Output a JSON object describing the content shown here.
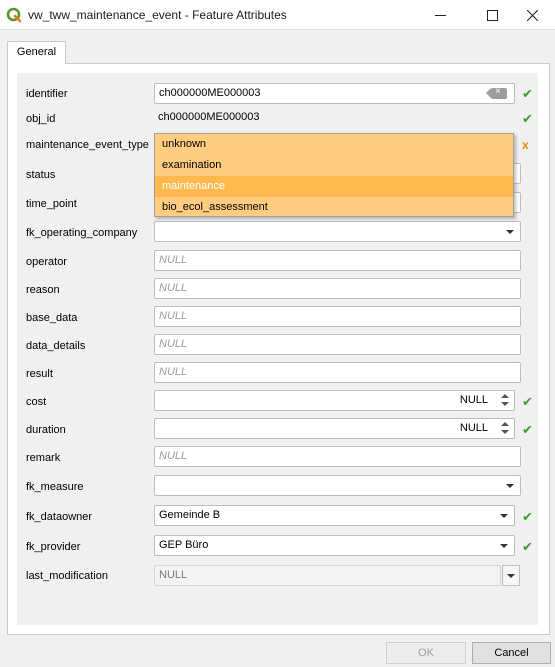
{
  "window": {
    "title": "vw_tww_maintenance_event - Feature Attributes",
    "icon": "qgis-icon",
    "controls": [
      "minimize-icon",
      "maximize-icon",
      "close-icon"
    ]
  },
  "tabs": [
    {
      "label": "General"
    }
  ],
  "fields": {
    "identifier": {
      "label": "identifier",
      "value": "ch000000ME000003"
    },
    "obj_id": {
      "label": "obj_id",
      "value": "ch000000ME000003"
    },
    "maintenance_event_type": {
      "label": "maintenance_event_type"
    },
    "status": {
      "label": "status"
    },
    "time_point": {
      "label": "time_point"
    },
    "fk_operating_company": {
      "label": "fk_operating_company",
      "value": ""
    },
    "operator": {
      "label": "operator",
      "placeholder": "NULL"
    },
    "reason": {
      "label": "reason",
      "placeholder": "NULL"
    },
    "base_data": {
      "label": "base_data",
      "placeholder": "NULL"
    },
    "data_details": {
      "label": "data_details",
      "placeholder": "NULL"
    },
    "result": {
      "label": "result",
      "placeholder": "NULL"
    },
    "cost": {
      "label": "cost",
      "value": "NULL"
    },
    "duration": {
      "label": "duration",
      "value": "NULL"
    },
    "remark": {
      "label": "remark",
      "placeholder": "NULL"
    },
    "fk_measure": {
      "label": "fk_measure",
      "value": ""
    },
    "fk_dataowner": {
      "label": "fk_dataowner",
      "value": "Gemeinde B"
    },
    "fk_provider": {
      "label": "fk_provider",
      "value": "GEP Büro"
    },
    "last_modification": {
      "label": "last_modification",
      "value": "NULL"
    }
  },
  "dropdown": {
    "options": [
      "unknown",
      "examination",
      "maintenance",
      "bio_ecol_assessment"
    ],
    "highlighted": "maintenance",
    "colors": {
      "background": "#ffcc80",
      "highlight": "#ffb84d"
    }
  },
  "marks": {
    "check": "✔",
    "warn": "x"
  },
  "status_colors": {
    "valid": "#3c9a2c",
    "warning": "#e08a00"
  },
  "buttons": {
    "ok": "OK",
    "cancel": "Cancel"
  }
}
